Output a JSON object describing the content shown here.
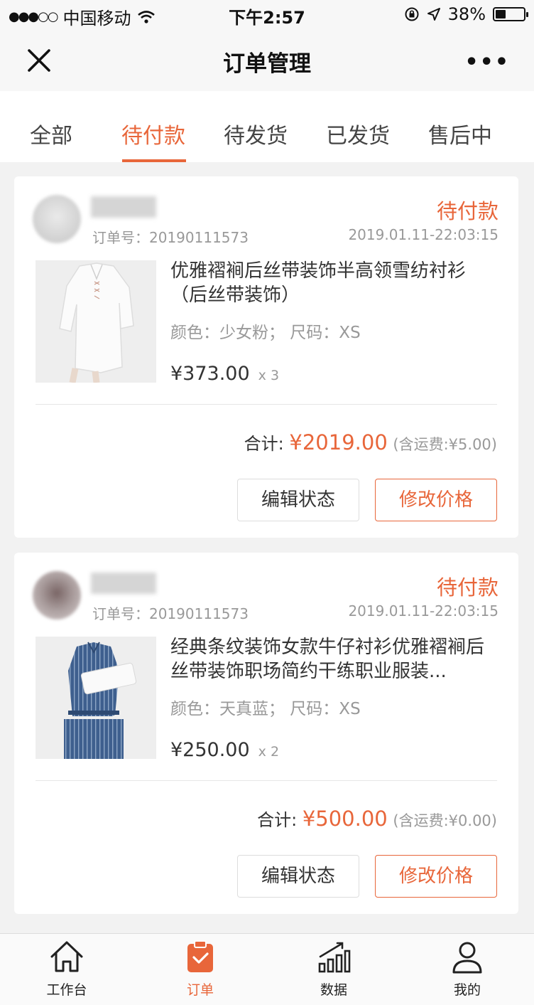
{
  "status_bar": {
    "signal_dots": "●●●○○",
    "carrier": "中国移动",
    "time": "下午2:57",
    "battery": "38%",
    "battery_level": 0.38
  },
  "nav": {
    "title": "订单管理",
    "more": "•••"
  },
  "tabs": [
    {
      "label": "全部",
      "active": false
    },
    {
      "label": "待付款",
      "active": true
    },
    {
      "label": "待发货",
      "active": false
    },
    {
      "label": "已发货",
      "active": false
    },
    {
      "label": "售后中",
      "active": false
    }
  ],
  "orders": [
    {
      "order_no": "订单号：20190111573",
      "status": "待付款",
      "datetime": "2019.01.11-22:03:15",
      "title": "优雅褶裥后丝带装饰半高领雪纺衬衫（后丝带装饰）",
      "attrs": "颜色：少女粉；  尺码：XS",
      "price": "¥373.00",
      "qty": "x 3",
      "total_label": "合计:",
      "total_amount": "¥2019.00",
      "shipping": "(含运费:¥5.00)",
      "edit_label": "编辑状态",
      "price_label": "修改价格"
    },
    {
      "order_no": "订单号：20190111573",
      "status": "待付款",
      "datetime": "2019.01.11-22:03:15",
      "title": "经典条纹装饰女款牛仔衬衫优雅褶裥后丝带装饰职场简约干练职业服装...",
      "attrs": "颜色：天真蓝；  尺码：XS",
      "price": "¥250.00",
      "qty": "x 2",
      "total_label": "合计:",
      "total_amount": "¥500.00",
      "shipping": "(含运费:¥0.00)",
      "edit_label": "编辑状态",
      "price_label": "修改价格"
    }
  ],
  "bottom_nav": [
    {
      "label": "工作台",
      "icon": "home-icon",
      "active": false
    },
    {
      "label": "订单",
      "icon": "clipboard-check-icon",
      "active": true
    },
    {
      "label": "数据",
      "icon": "bar-chart-icon",
      "active": false
    },
    {
      "label": "我的",
      "icon": "user-icon",
      "active": false
    }
  ],
  "colors": {
    "accent": "#e8663a",
    "background": "#f2f2f2"
  }
}
